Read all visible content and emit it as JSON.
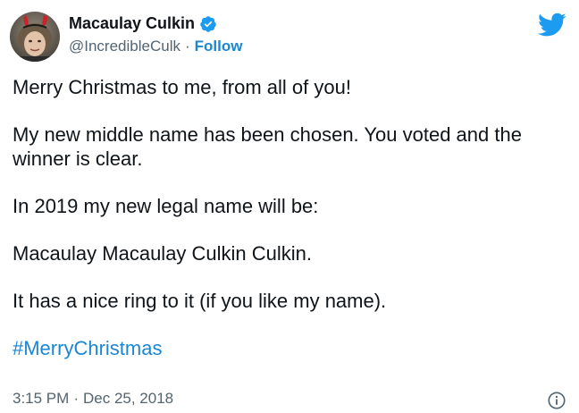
{
  "author": {
    "display_name": "Macaulay Culkin",
    "handle": "@IncredibleCulk",
    "separator": "·",
    "follow_label": "Follow",
    "verified_icon": "verified-badge-icon"
  },
  "tweet": {
    "paragraphs": [
      "Merry Christmas to me, from all of you!",
      "My new middle name has been chosen. You voted and the winner is clear.",
      "In 2019 my new legal name will be:",
      "Macaulay Macaulay Culkin Culkin.",
      "It has a nice ring to it (if you like my name)."
    ],
    "hashtag": "#MerryChristmas"
  },
  "meta": {
    "time": "3:15 PM",
    "separator": "·",
    "date": "Dec 25, 2018"
  },
  "icons": {
    "logo": "twitter-bird-icon",
    "info": "info-icon"
  },
  "colors": {
    "link_blue": "#1b86d2",
    "twitter_blue": "#1d9bf0",
    "muted_gray": "#536471",
    "text": "#0f1419"
  }
}
